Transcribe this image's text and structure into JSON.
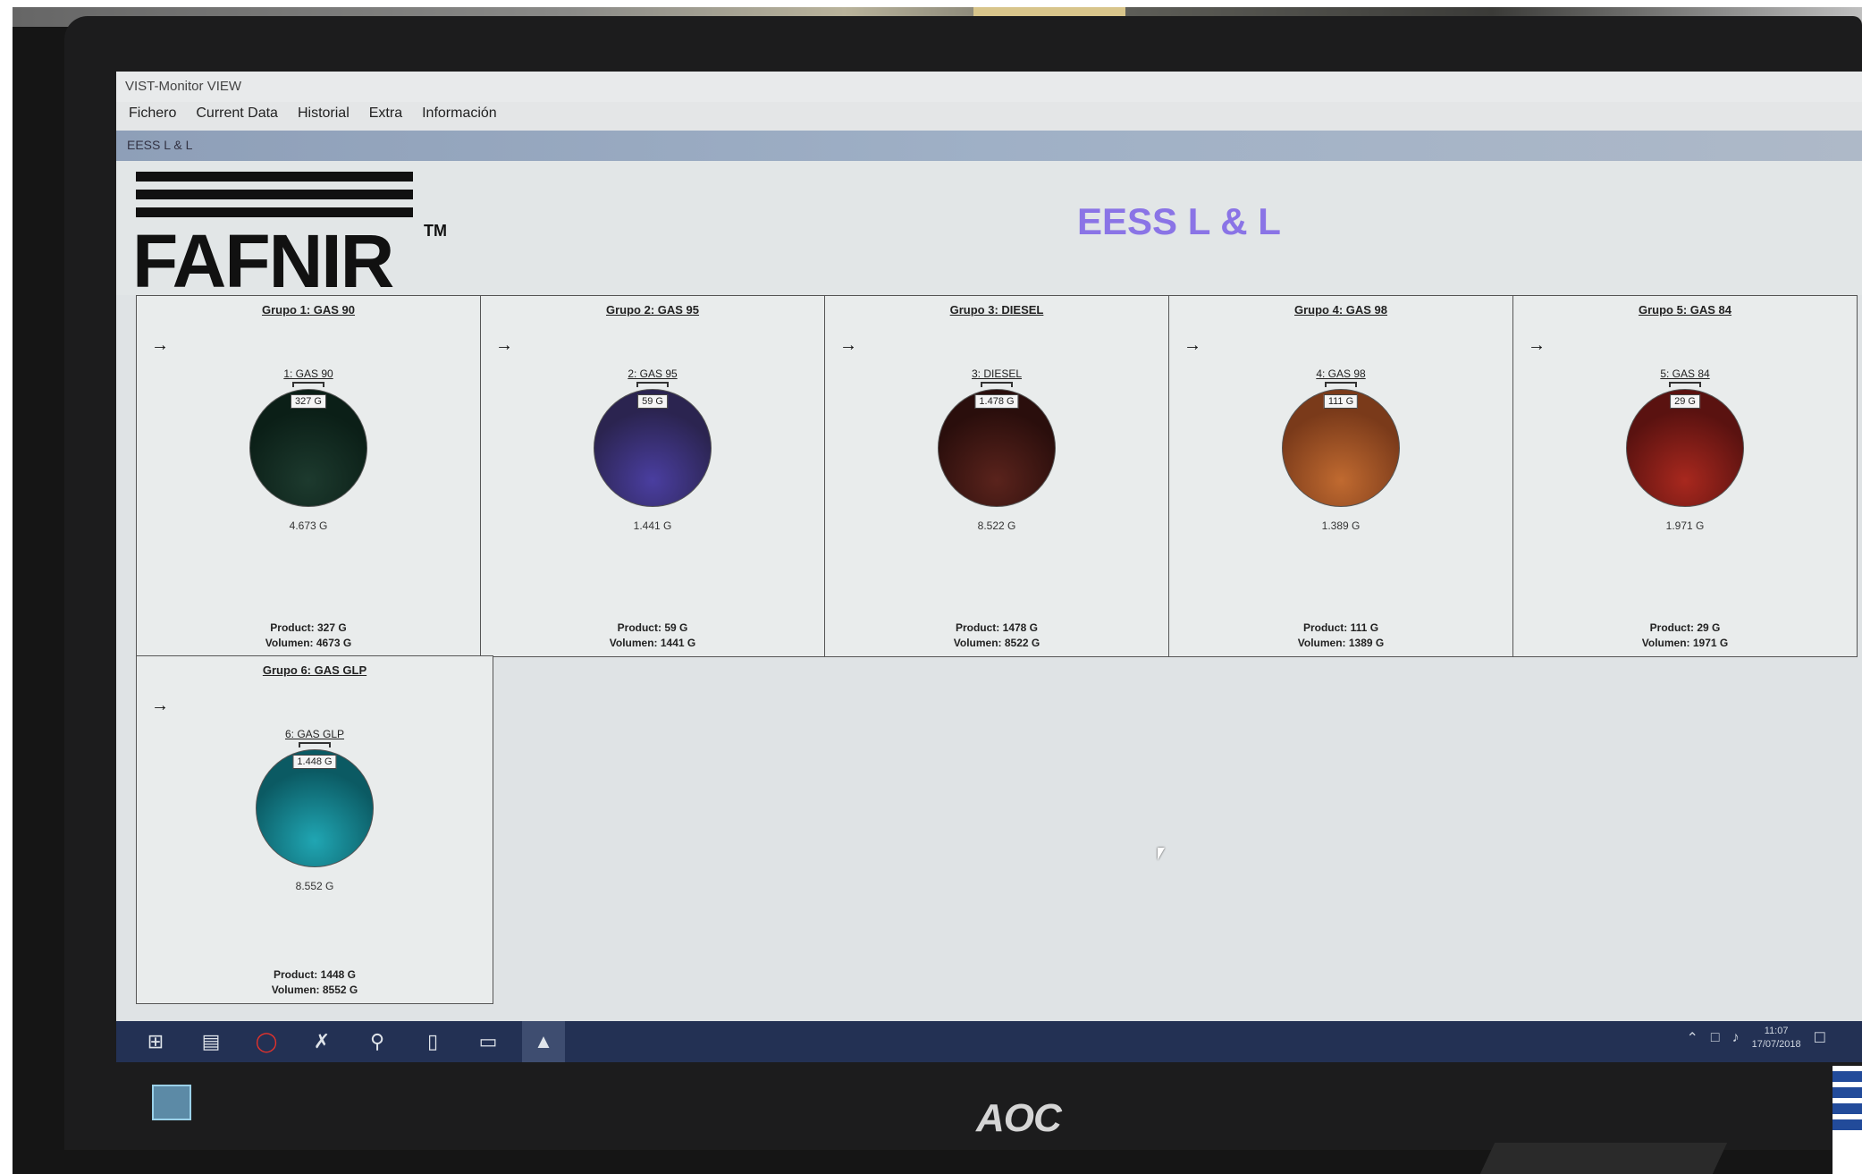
{
  "window": {
    "title": "VIST-Monitor VIEW",
    "subtitle": "EESS L & L"
  },
  "menu": [
    "Fichero",
    "Current Data",
    "Historial",
    "Extra",
    "Información"
  ],
  "logo": {
    "text": "FAFNIR",
    "tm": "TM"
  },
  "station_title": "EESS L & L",
  "groups": [
    {
      "title": "Grupo 1: GAS 90",
      "tank": "1: GAS 90",
      "fill": "327 G",
      "capacity": "4.673 G",
      "product": "327 G",
      "volume": "4673 G",
      "color": "#0b1f17",
      "highlight": "#1d3a2e"
    },
    {
      "title": "Grupo 2: GAS 95",
      "tank": "2: GAS 95",
      "fill": "59 G",
      "capacity": "1.441 G",
      "product": "59 G",
      "volume": "1441 G",
      "color": "#2b2450",
      "highlight": "#4a3ea0"
    },
    {
      "title": "Grupo 3: DIESEL",
      "tank": "3: DIESEL",
      "fill": "1.478 G",
      "capacity": "8.522 G",
      "product": "1478 G",
      "volume": "8522 G",
      "color": "#2a0e0c",
      "highlight": "#5a231c"
    },
    {
      "title": "Grupo 4: GAS 98",
      "tank": "4: GAS 98",
      "fill": "111 G",
      "capacity": "1.389 G",
      "product": "111 G",
      "volume": "1389 G",
      "color": "#7a3a1a",
      "highlight": "#c06a30"
    },
    {
      "title": "Grupo 5: GAS 84",
      "tank": "5: GAS 84",
      "fill": "29 G",
      "capacity": "1.971 G",
      "product": "29 G",
      "volume": "1971 G",
      "color": "#5a1210",
      "highlight": "#a8281e"
    },
    {
      "title": "Grupo 6: GAS GLP",
      "tank": "6: GAS GLP",
      "fill": "1.448 G",
      "capacity": "8.552 G",
      "product": "1448 G",
      "volume": "8552 G",
      "color": "#0b5a63",
      "highlight": "#20a6b3"
    }
  ],
  "labels": {
    "product": "Product:",
    "volume": "Volumen:",
    "arrow": "→"
  },
  "taskbar": {
    "icons": [
      "windows-icon",
      "file-explorer-icon",
      "opera-icon",
      "tools-icon",
      "search-icon",
      "document-icon",
      "folder-icon",
      "monitor-app-icon"
    ],
    "clock_time": "11:07",
    "clock_date": "17/07/2018"
  },
  "monitor": {
    "brand": "AOC"
  }
}
